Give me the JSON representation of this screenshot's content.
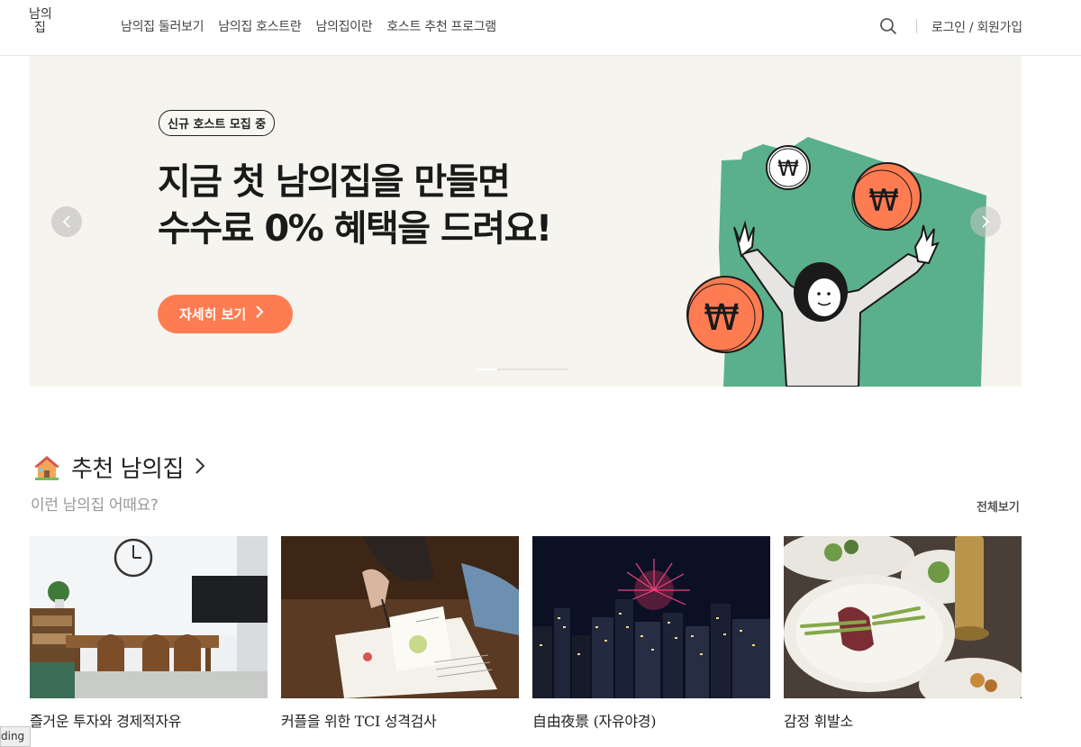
{
  "header": {
    "logo": [
      "남의",
      "집"
    ],
    "nav": [
      "남의집 둘러보기",
      "남의집 호스트란",
      "남의집이란",
      "호스트 추천 프로그램"
    ],
    "search_icon": "search-icon",
    "login": "로그인 / 회원가입"
  },
  "hero": {
    "badge": "신규 호스트 모집 중",
    "title_line1": "지금 첫 남의집을 만들면",
    "title_line2": "수수료 0% 혜택을 드려요!",
    "cta": "자세히 보기",
    "cta_icon": "chevron-right-icon",
    "coin_symbol": "₩",
    "colors": {
      "background": "#f5f4ef",
      "house": "#5ab08a",
      "coin": "#ff7b52",
      "cta": "#ff7b52"
    },
    "prev_icon": "chevron-left-icon",
    "next_icon": "chevron-right-icon"
  },
  "section": {
    "icon": "house-icon",
    "title": "추천 남의집",
    "chevron": "›",
    "subtitle": "이런 남의집 어때요?",
    "view_all": "전체보기",
    "cards": [
      {
        "title": "즐거운 투자와 경제적자유"
      },
      {
        "title": "커플을 위한 TCI 성격검사"
      },
      {
        "title": "自由夜景 (자유야경)"
      },
      {
        "title": "감정 휘발소"
      }
    ]
  },
  "status_bar": {
    "text": "ding"
  }
}
